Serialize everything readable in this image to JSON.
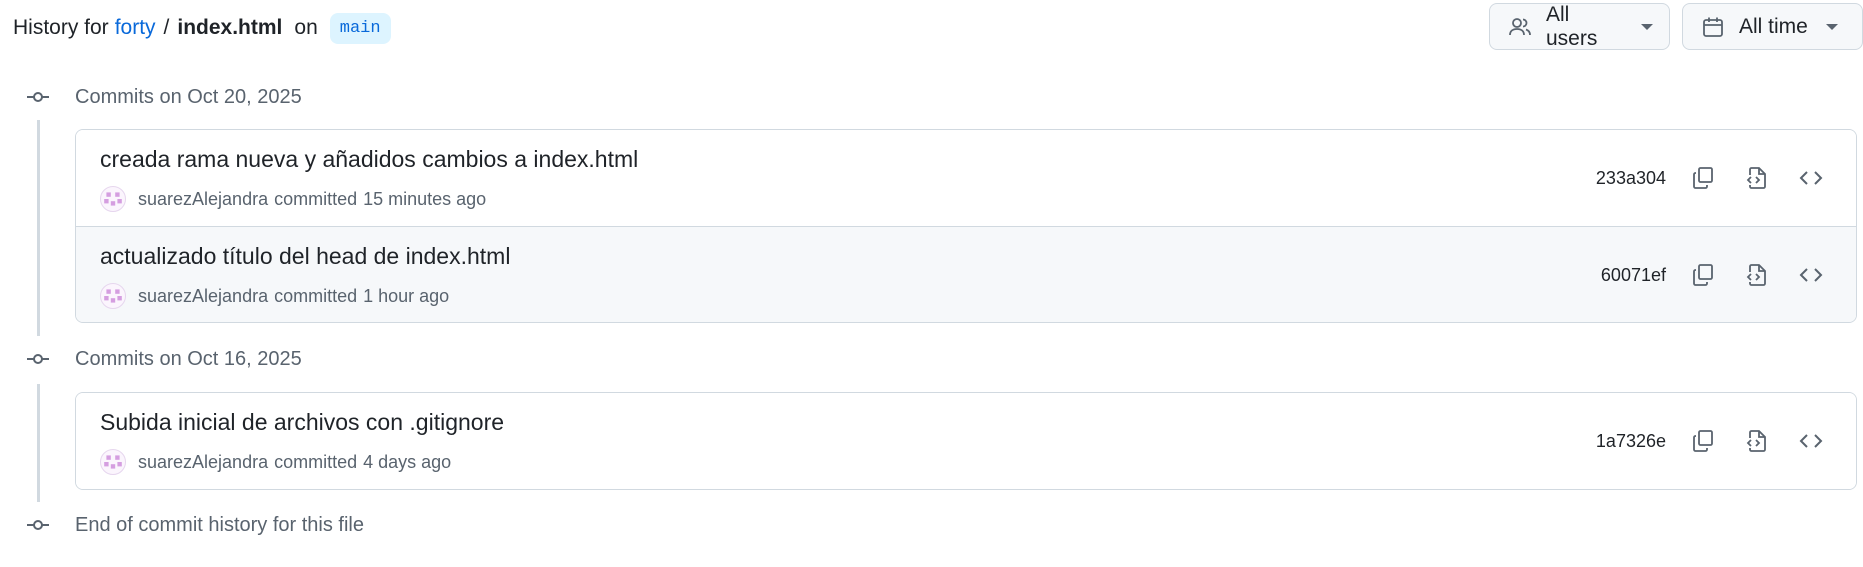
{
  "header": {
    "prefix": "History for",
    "repo": "forty",
    "separator": "/",
    "file": "index.html",
    "on": "on",
    "branch": "main"
  },
  "filters": {
    "users_label": "All users",
    "time_label": "All time"
  },
  "groups": [
    {
      "label": "Commits on Oct 20, 2025",
      "commits": [
        {
          "title": "creada rama nueva y añadidos cambios a index.html",
          "author": "suarezAlejandra",
          "committed": "committed",
          "ago": "15 minutes ago",
          "sha": "233a304"
        },
        {
          "title": "actualizado título del head de index.html",
          "author": "suarezAlejandra",
          "committed": "committed",
          "ago": "1 hour ago",
          "sha": "60071ef"
        }
      ]
    },
    {
      "label": "Commits on Oct 16, 2025",
      "commits": [
        {
          "title": "Subida inicial de archivos con .gitignore",
          "author": "suarezAlejandra",
          "committed": "committed",
          "ago": "4 days ago",
          "sha": "1a7326e"
        }
      ]
    }
  ],
  "end_label": "End of commit history for this file",
  "icons": {
    "commit": "git-commit-icon",
    "people": "people-icon",
    "calendar": "calendar-icon",
    "copy": "copy-icon",
    "view_file": "file-code-icon",
    "browse": "code-icon"
  },
  "colors": {
    "link": "#0969da",
    "branch_bg": "#ddf4ff",
    "muted": "#59636e",
    "border": "#d1d9e0",
    "alt_row": "#f6f8fa"
  }
}
